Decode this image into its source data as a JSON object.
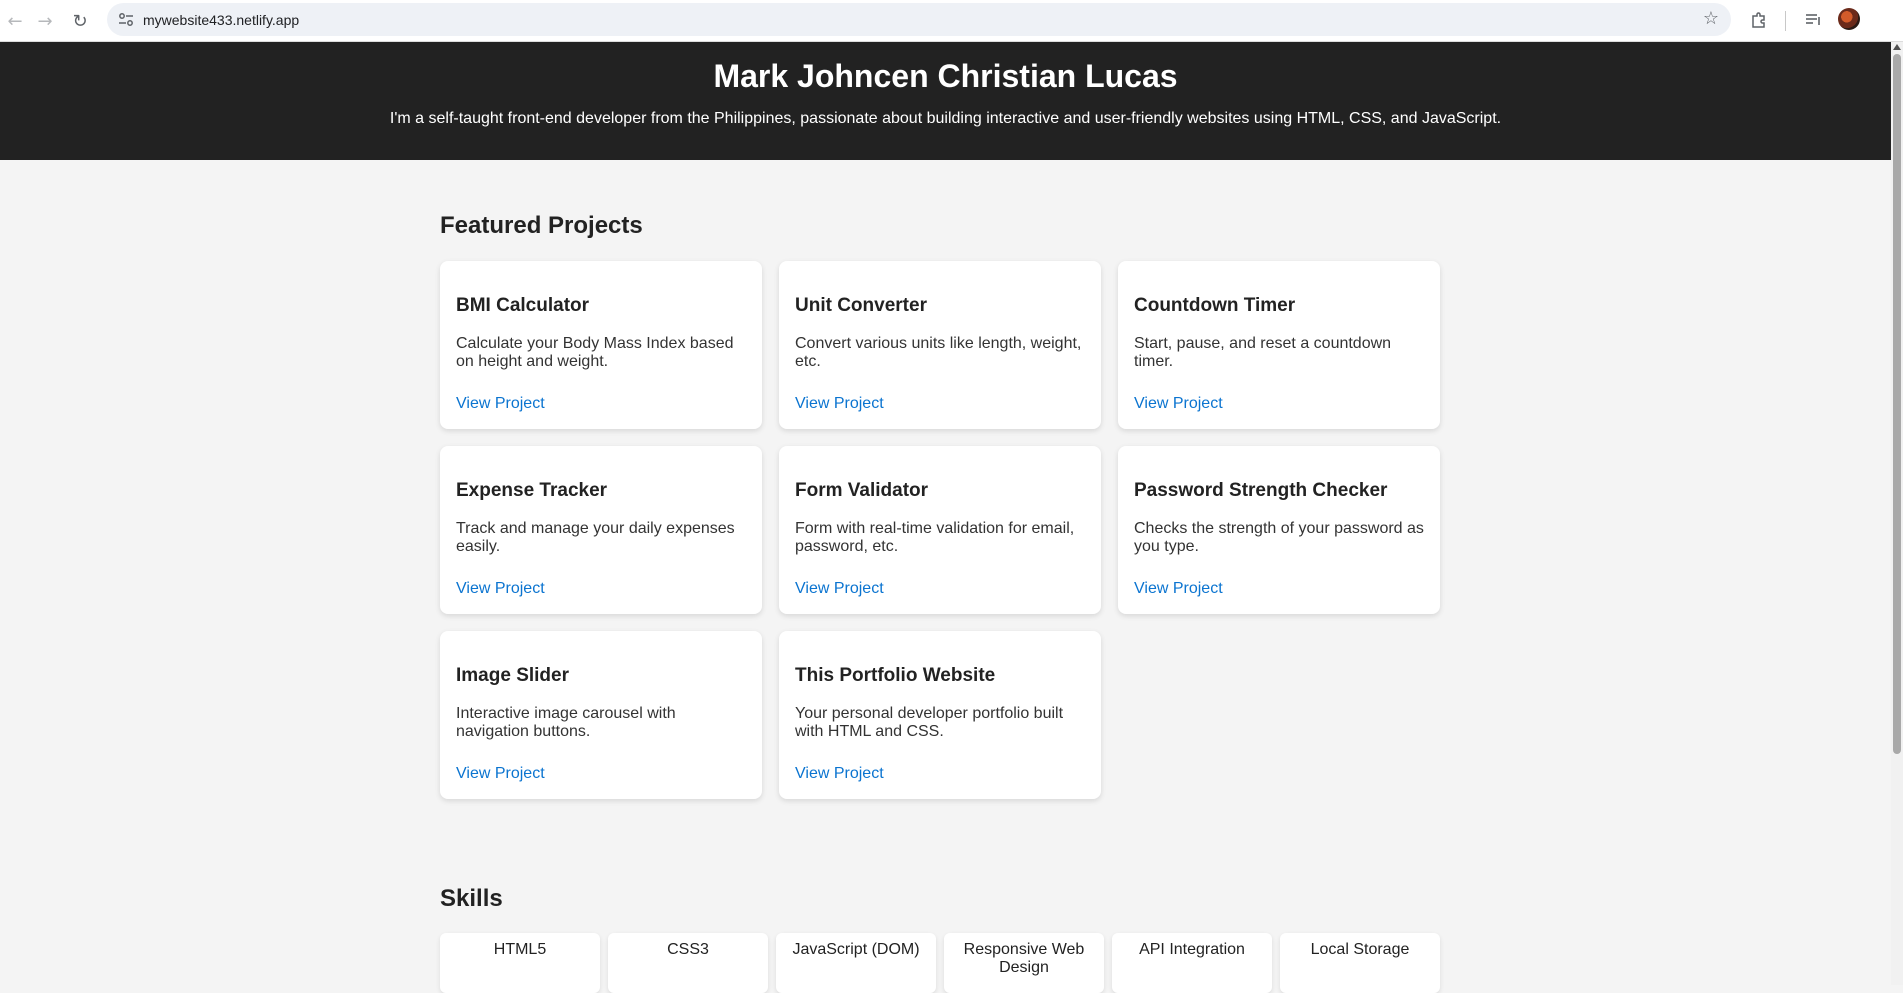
{
  "browser": {
    "url": "mywebsite433.netlify.app",
    "icons": {
      "back": "back-arrow-icon",
      "forward": "forward-arrow-icon",
      "reload": "reload-icon",
      "site_info": "site-info-icon",
      "bookmark": "star-icon",
      "extensions": "puzzle-icon",
      "media": "media-queue-icon",
      "profile": "avatar"
    }
  },
  "hero": {
    "name": "Mark Johncen Christian Lucas",
    "tagline": "I'm a self-taught front-end developer from the Philippines, passionate about building interactive and user-friendly websites using HTML, CSS, and JavaScript."
  },
  "projects": {
    "heading": "Featured Projects",
    "items": [
      {
        "title": "BMI Calculator",
        "description": "Calculate your Body Mass Index based on height and weight.",
        "link": "View Project"
      },
      {
        "title": "Unit Converter",
        "description": "Convert various units like length, weight, etc.",
        "link": "View Project"
      },
      {
        "title": "Countdown Timer",
        "description": "Start, pause, and reset a countdown timer.",
        "link": "View Project"
      },
      {
        "title": "Expense Tracker",
        "description": "Track and manage your daily expenses easily.",
        "link": "View Project"
      },
      {
        "title": "Form Validator",
        "description": "Form with real-time validation for email, password, etc.",
        "link": "View Project"
      },
      {
        "title": "Password Strength Checker",
        "description": "Checks the strength of your password as you type.",
        "link": "View Project"
      },
      {
        "title": "Image Slider",
        "description": "Interactive image carousel with navigation buttons.",
        "link": "View Project"
      },
      {
        "title": "This Portfolio Website",
        "description": "Your personal developer portfolio built with HTML and CSS.",
        "link": "View Project"
      }
    ]
  },
  "skills": {
    "heading": "Skills",
    "items": [
      "HTML5",
      "CSS3",
      "JavaScript (DOM)",
      "Responsive Web Design",
      "API Integration",
      "Local Storage"
    ]
  },
  "colors": {
    "hero_bg": "#222222",
    "page_bg": "#f4f4f4",
    "link": "#0b74d0"
  }
}
